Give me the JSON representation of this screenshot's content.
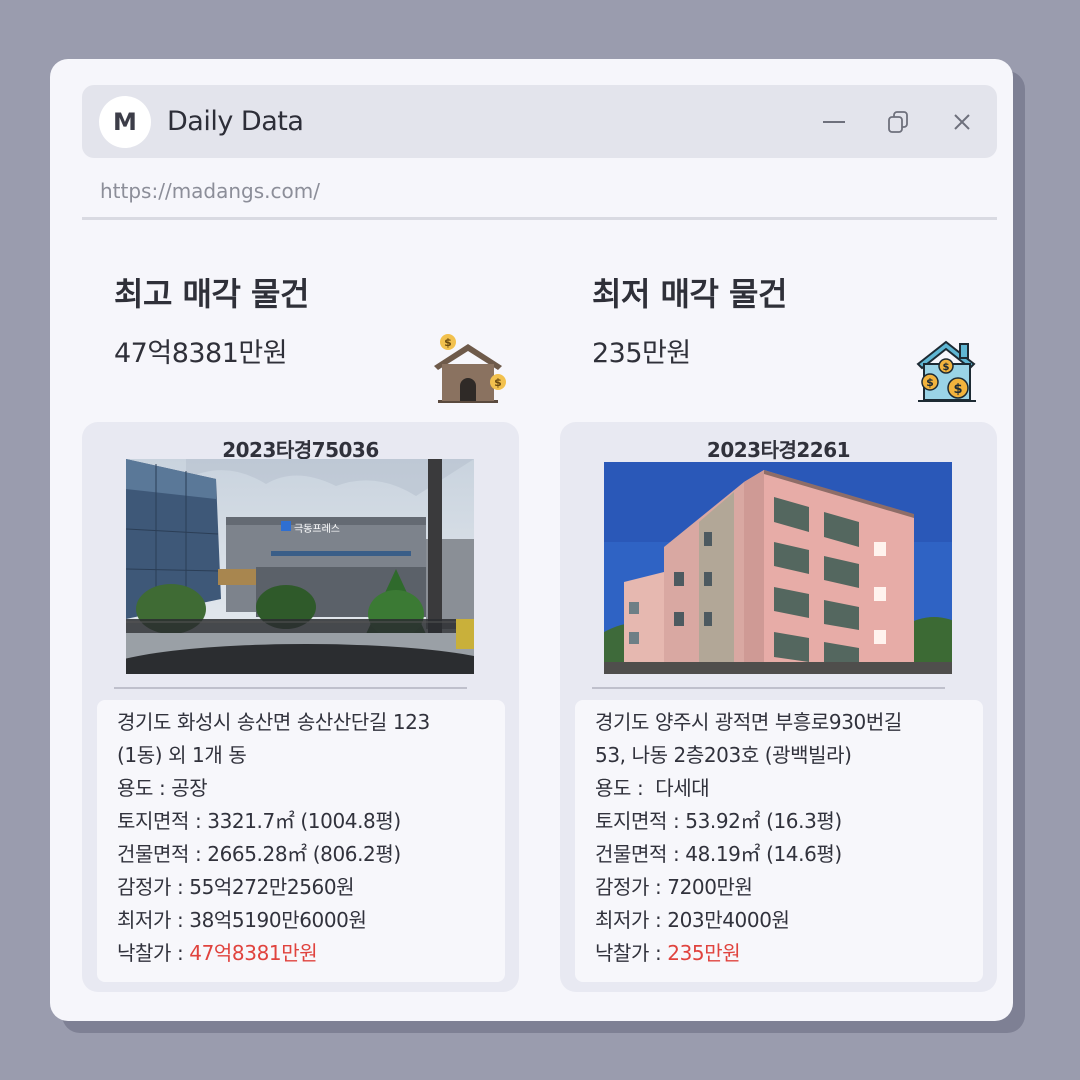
{
  "window": {
    "logo": "M",
    "title": "Daily Data",
    "url": "https://madangs.com/",
    "controls": [
      "minimize-icon",
      "restore-icon",
      "close-icon"
    ]
  },
  "highest": {
    "heading": "최고 매각 물건",
    "price": "47억8381만원",
    "icon": "money-house-icon",
    "case_no": "2023타경75036",
    "address_line1": "경기도 화성시 송산면 송산산단길 123",
    "address_line2": "(1동) 외 1개 동",
    "usage": "용도 : 공장",
    "land_area": "토지면적 : 3321.7㎡ (1004.8평)",
    "building_area": "건물면적 : 2665.28㎡ (806.2평)",
    "appraisal": "감정가 : 55억272만2560원",
    "minimum": "최저가 : 38억5190만6000원",
    "winning_label": "낙찰가 : ",
    "winning_value": "47억8381만원",
    "photo_sign": "극동프레스"
  },
  "lowest": {
    "heading": "최저 매각 물건",
    "price": "235만원",
    "icon": "house-coins-icon",
    "case_no": "2023타경2261",
    "address_line1": "경기도 양주시 광적면 부흥로930번길",
    "address_line2": "53, 나동 2층203호 (광백빌라)",
    "usage": "용도 :  다세대",
    "land_area": "토지면적 : 53.92㎡ (16.3평)",
    "building_area": "건물면적 : 48.19㎡ (14.6평)",
    "appraisal": "감정가 : 7200만원",
    "minimum": "최저가 : 203만4000원",
    "winning_label": "낙찰가 : ",
    "winning_value": "235만원"
  },
  "colors": {
    "background": "#9a9cae",
    "window": "#f6f6fb",
    "titlebar": "#e3e4ec",
    "card": "#e8e9f2",
    "highlight": "#e0433e"
  }
}
